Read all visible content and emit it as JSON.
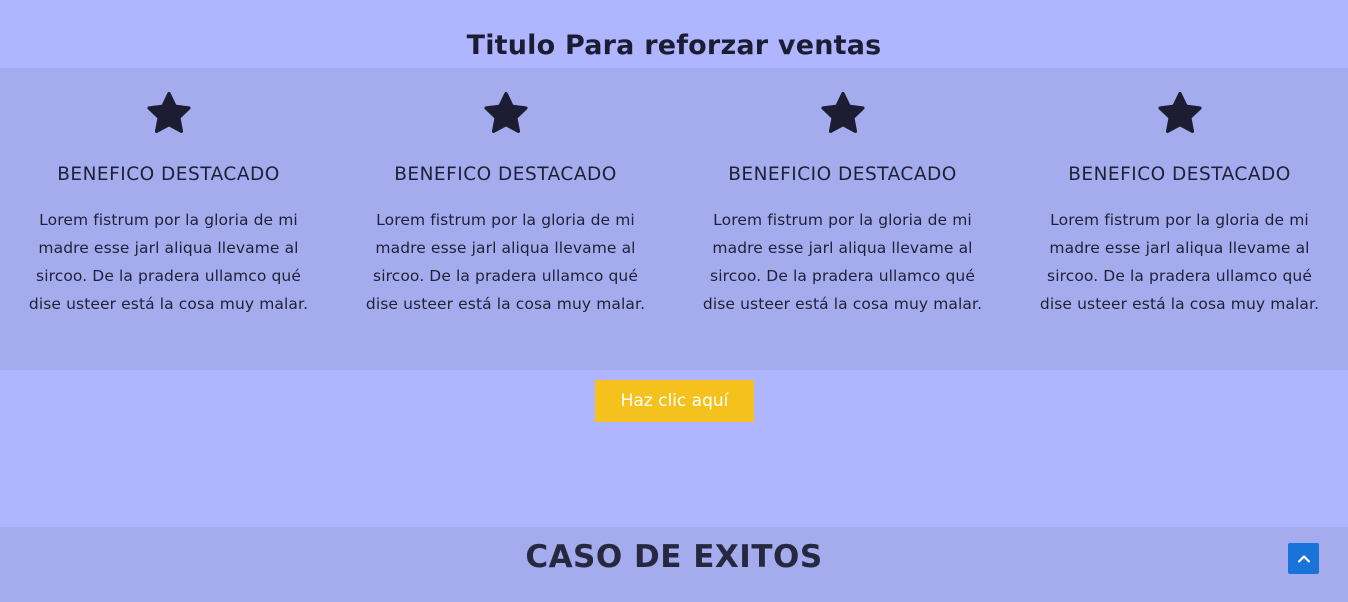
{
  "section_title": "Titulo Para reforzar ventas",
  "benefits": [
    {
      "icon": "star-icon",
      "title": "BENEFICO DESTACADO",
      "text": "Lorem fistrum por la gloria de mi madre esse jarl aliqua llevame al sircoo. De la pradera ullamco qué dise usteer está la cosa muy malar."
    },
    {
      "icon": "star-icon",
      "title": "BENEFICO DESTACADO",
      "text": "Lorem fistrum por la gloria de mi madre esse jarl aliqua llevame al sircoo. De la pradera ullamco qué dise usteer está la cosa muy malar."
    },
    {
      "icon": "star-icon",
      "title": "BENEFICIO DESTACADO",
      "text": "Lorem fistrum por la gloria de mi madre esse jarl aliqua llevame al sircoo. De la pradera ullamco qué dise usteer está la cosa muy malar."
    },
    {
      "icon": "star-icon",
      "title": "BENEFICO DESTACADO",
      "text": "Lorem fistrum por la gloria de mi madre esse jarl aliqua llevame al sircoo. De la pradera ullamco qué dise usteer está la cosa muy malar."
    }
  ],
  "cta": {
    "label": "Haz clic aquí"
  },
  "cases": {
    "title": "CASO DE EXITOS"
  },
  "scroll_top": {
    "icon": "chevron-up-icon"
  },
  "colors": {
    "page_background": "#b0b5ff",
    "band_background": "#a5acee",
    "text": "#1f2037",
    "button": "#f5c21d",
    "scroll_button": "#1a73d9"
  }
}
